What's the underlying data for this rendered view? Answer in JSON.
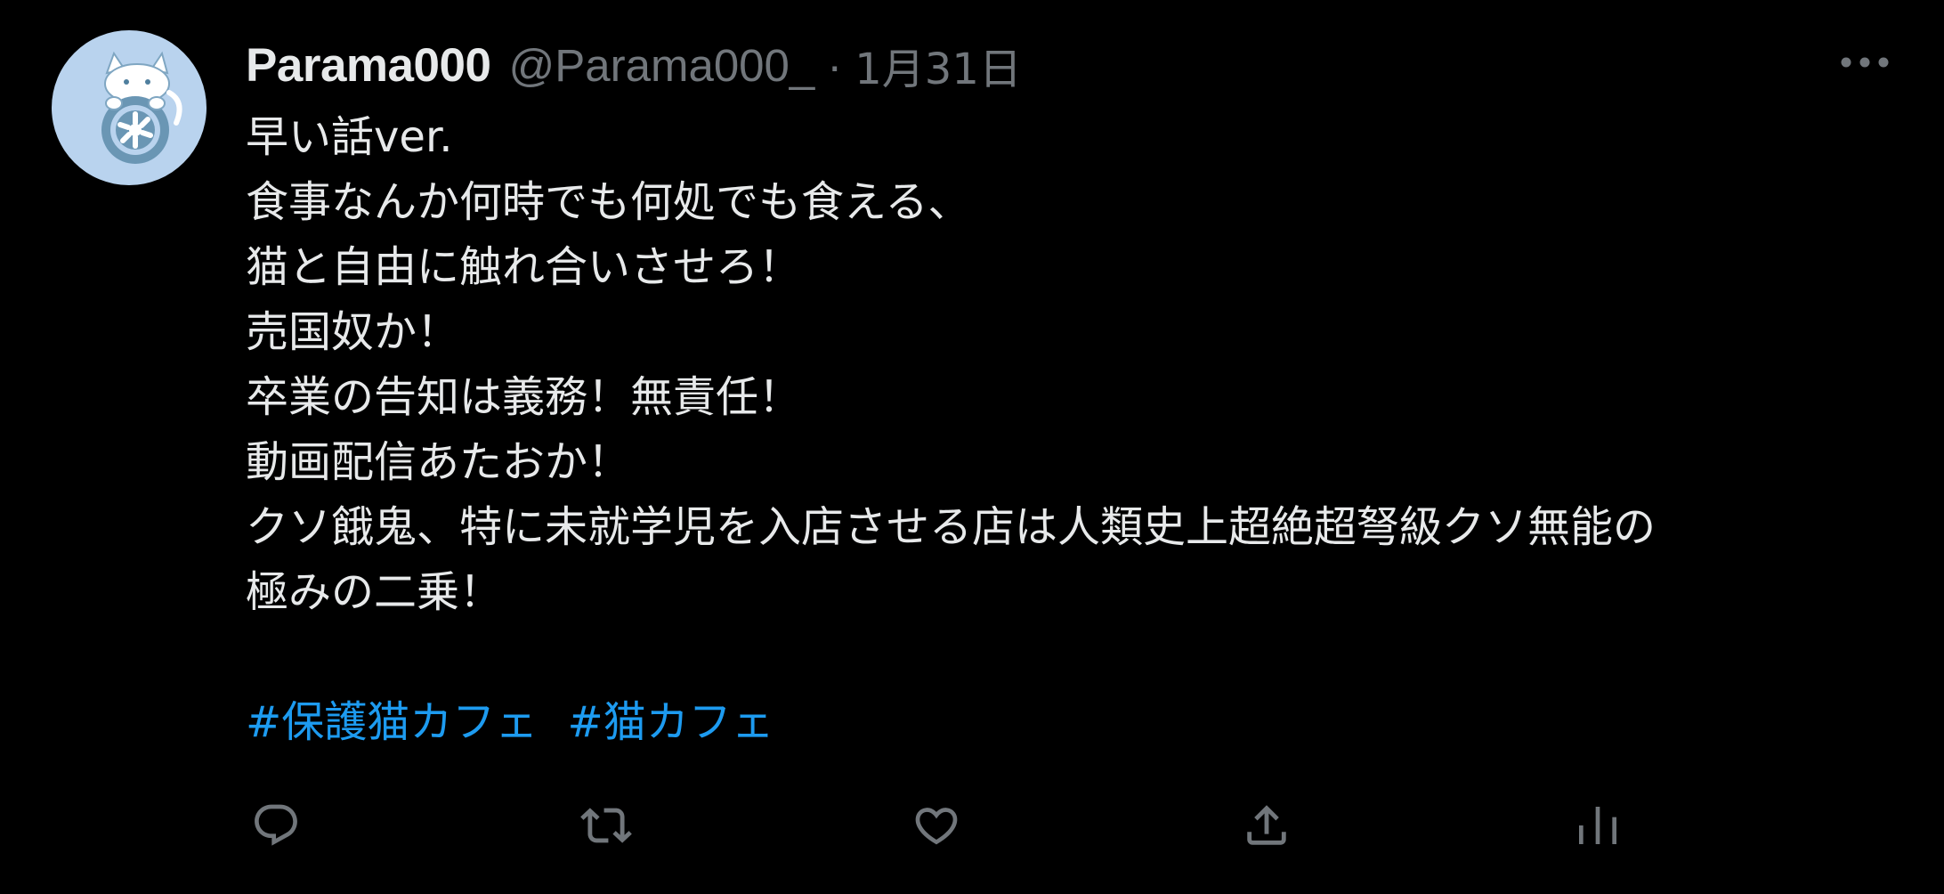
{
  "tweet": {
    "display_name": "Parama000",
    "handle": "@Parama000_",
    "separator": "·",
    "timestamp": "1月31日",
    "lines": [
      "早い話ver.",
      "食事なんか何時でも何処でも食える、",
      "猫と自由に触れ合いさせろ！",
      "売国奴か！",
      "卒業の告知は義務！無責任！",
      "動画配信あたおか！",
      "クソ餓鬼、特に未就学児を入店させる店は人類史上超絶超弩級クソ無能の",
      "極みの二乗！"
    ],
    "hashtags": [
      "#保護猫カフェ",
      "#猫カフェ"
    ]
  },
  "icons": {
    "avatar": "cat-with-wheel-avatar",
    "more": "more-horizontal-icon",
    "reply": "reply-icon",
    "retweet": "retweet-icon",
    "like": "heart-icon",
    "share": "share-icon",
    "analytics": "analytics-icon"
  },
  "colors": {
    "background": "#000000",
    "text": "#e7e9ea",
    "secondary": "#71767b",
    "link": "#1d9bf0",
    "avatar_bg": "#b9d3ee"
  }
}
